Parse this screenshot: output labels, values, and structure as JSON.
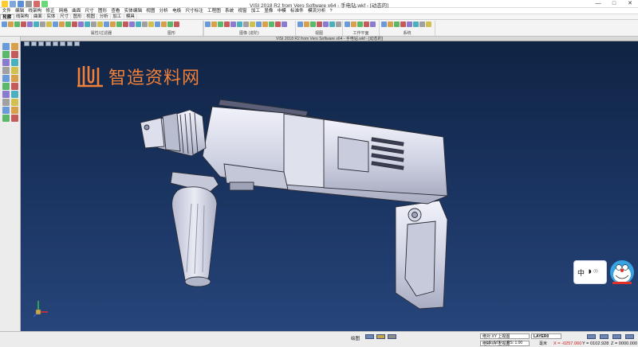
{
  "window": {
    "title": "VISI 2018 R2 from Vero Software x64 - 手电钻.wkf - [动态的]",
    "controls": [
      "—",
      "□",
      "✕"
    ]
  },
  "menu": [
    "文件",
    "编辑",
    "线架构",
    "修正",
    "网格",
    "曲面",
    "尺寸",
    "图形",
    "查看",
    "实体编辑",
    "视图",
    "分析",
    "电极",
    "尺寸标注",
    "工程图",
    "系统",
    "视窗",
    "加工",
    "显像",
    "中模",
    "标准件",
    "模流分析",
    "?"
  ],
  "ribbon_tabs": [
    "轮廓",
    "线架构",
    "曲面",
    "实体",
    "尺寸",
    "图形",
    "视图",
    "分析",
    "加工",
    "模具"
  ],
  "ribbon_groups": [
    {
      "label": "属性/过滤器"
    },
    {
      "label": "图形"
    },
    {
      "label": "图像 (进阶)"
    },
    {
      "label": "视图"
    },
    {
      "label": "工作平面"
    },
    {
      "label": "系统"
    }
  ],
  "watermark": {
    "text": "智造资料网",
    "color": "#f0803a"
  },
  "ime": {
    "label": "中",
    "extra": "◗ ☉"
  },
  "status": {
    "mode": "绘图",
    "workplane": "绝对 XY 上视图",
    "constrain": "绝对 XY 上视图",
    "layer": "LAYER0",
    "ls": "LS: 1.00",
    "ps": "PS: 1.00",
    "unit": "毫米",
    "x": "X = -0257.060",
    "y": "Y = 0102.928",
    "z": "Z = 0000.000"
  },
  "colors": {
    "viewport_top": "#0f2342",
    "viewport_bottom": "#27457a",
    "model": "#d3d6e4",
    "model_edge": "#2a2d38",
    "accent": "#f0803a"
  }
}
